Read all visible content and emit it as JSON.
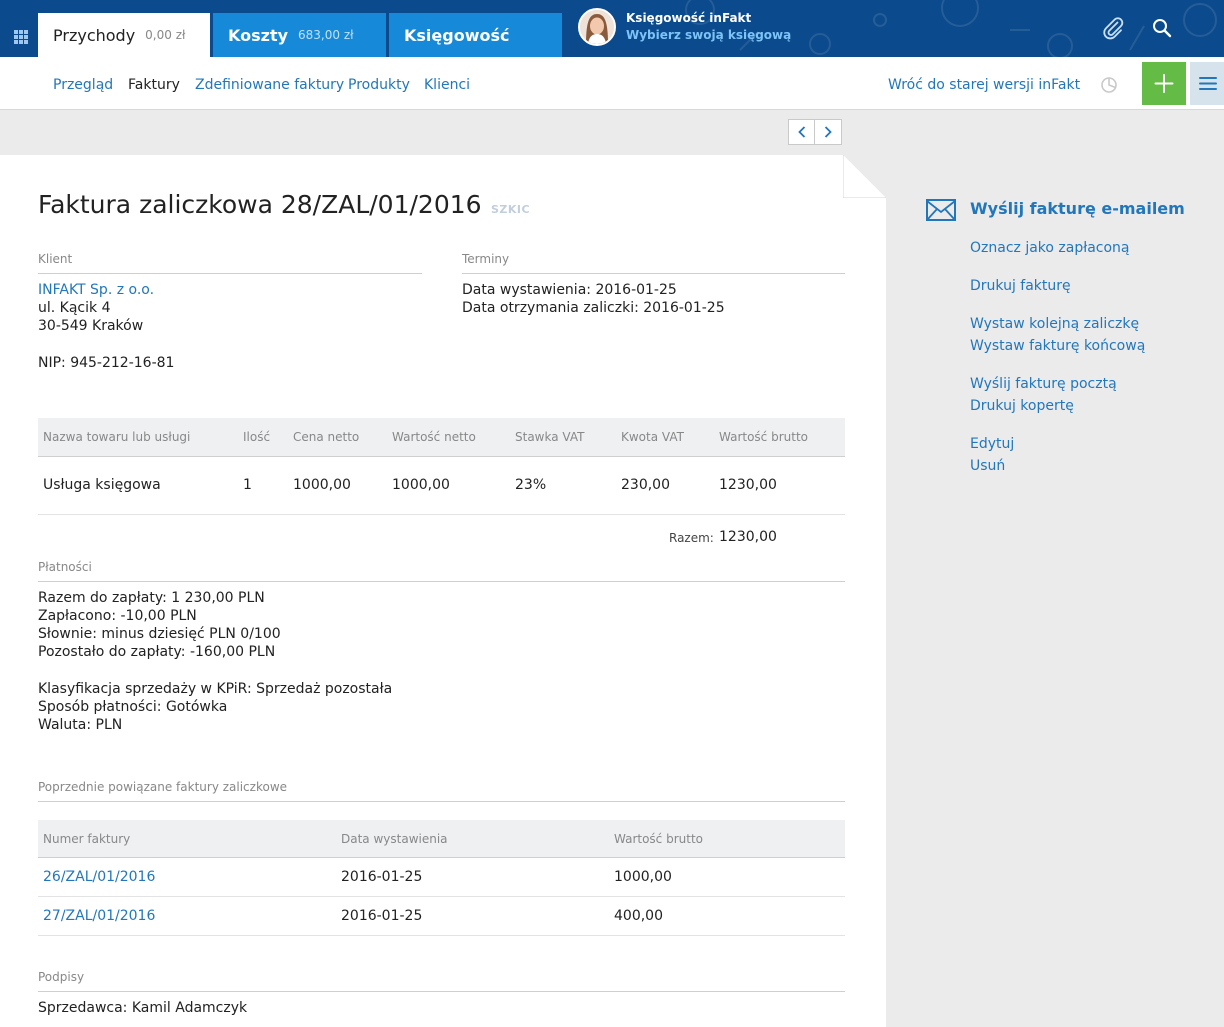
{
  "topbar": {
    "tabs": [
      {
        "label": "Przychody",
        "amount": "0,00 zł"
      },
      {
        "label": "Koszty",
        "amount": "683,00 zł"
      },
      {
        "label": "Księgowość"
      }
    ],
    "account": {
      "title": "Księgowość inFakt",
      "subtitle": "Wybierz swoją księgową"
    },
    "icons": [
      "apps-grid-icon",
      "paperclip-icon",
      "search-icon"
    ]
  },
  "subnav": {
    "items": [
      "Przegląd",
      "Faktury",
      "Zdefiniowane faktury",
      "Produkty",
      "Klienci"
    ],
    "current": "Faktury",
    "back_link": "Wróć do starej wersji inFakt"
  },
  "colors": {
    "brand_dark": "#0b4a8c",
    "brand_blue": "#1689d8",
    "link": "#2277bb",
    "add_green": "#64bc46"
  },
  "invoice": {
    "title": "Faktura zaliczkowa 28/ZAL/01/2016",
    "status": "SZKIC",
    "client": {
      "label": "Klient",
      "name": "INFAKT Sp. z o.o.",
      "street": "ul. Kącik 4",
      "city": "30-549 Kraków",
      "nip": "NIP: 945-212-16-81"
    },
    "terms": {
      "label": "Terminy",
      "issue_date": "Data wystawienia: 2016-01-25",
      "advance_date": "Data otrzymania zaliczki: 2016-01-25"
    },
    "items": {
      "headers": [
        "Nazwa towaru lub usługi",
        "Ilość",
        "Cena netto",
        "Wartość netto",
        "Stawka VAT",
        "Kwota VAT",
        "Wartość brutto"
      ],
      "rows": [
        [
          "Usługa księgowa",
          "1",
          "1000,00",
          "1000,00",
          "23%",
          "230,00",
          "1230,00"
        ]
      ],
      "total_label": "Razem:",
      "total_value": "1230,00"
    },
    "payments": {
      "label": "Płatności",
      "lines": [
        "Razem do zapłaty: 1 230,00 PLN",
        "Zapłacono: -10,00 PLN",
        "Słownie: minus dziesięć PLN 0/100",
        "Pozostało do zapłaty: -160,00 PLN"
      ],
      "details": [
        "Klasyfikacja sprzedaży w KPiR: Sprzedaż pozostała",
        "Sposób płatności: Gotówka",
        "Waluta: PLN"
      ]
    },
    "related": {
      "label": "Poprzednie powiązane faktury zaliczkowe",
      "headers": [
        "Numer faktury",
        "Data wystawienia",
        "Wartość brutto"
      ],
      "rows": [
        [
          "26/ZAL/01/2016",
          "2016-01-25",
          "1000,00"
        ],
        [
          "27/ZAL/01/2016",
          "2016-01-25",
          "400,00"
        ]
      ]
    },
    "signatures": {
      "label": "Podpisy",
      "seller": "Sprzedawca: Kamil Adamczyk"
    }
  },
  "actions": {
    "send_email": "Wyślij fakturę e-mailem",
    "mark_paid": "Oznacz jako zapłaconą",
    "print": "Drukuj fakturę",
    "next_advance": "Wystaw kolejną zaliczkę",
    "final_invoice": "Wystaw fakturę końcową",
    "send_post": "Wyślij fakturę pocztą",
    "print_envelope": "Drukuj kopertę",
    "edit": "Edytuj",
    "delete": "Usuń"
  }
}
